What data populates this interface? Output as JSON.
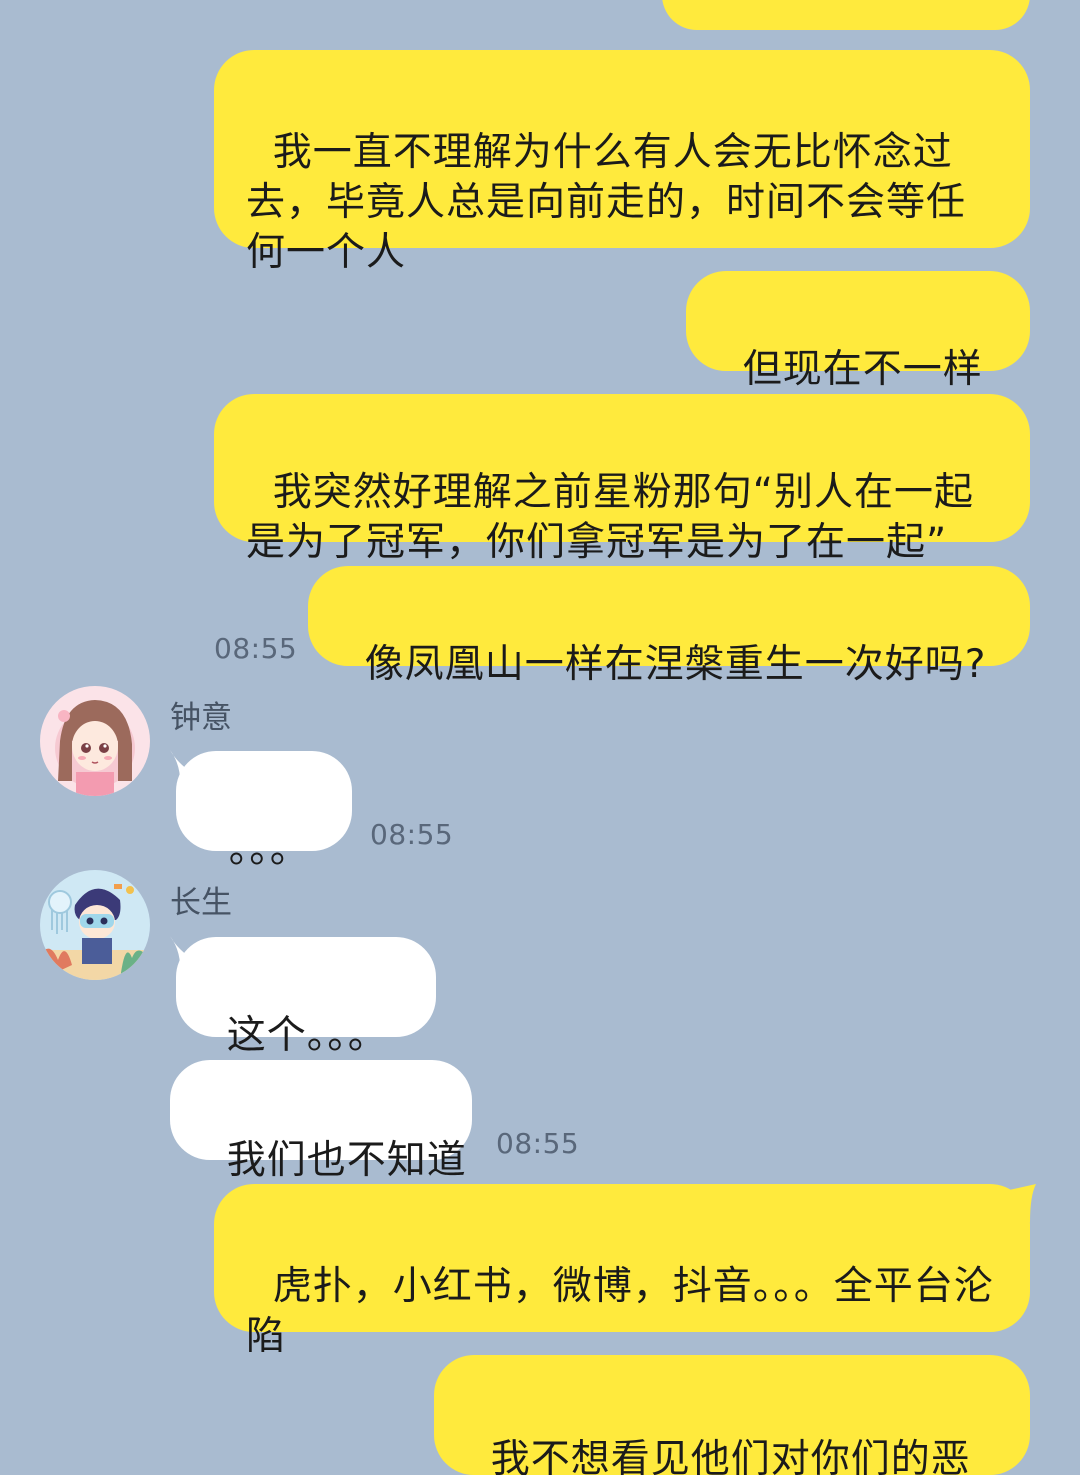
{
  "messages": {
    "m1": {
      "text": "我一直不理解为什么有人会无比怀念过去，毕竟人总是向前走的，时间不会等任何一个人"
    },
    "m2": {
      "text": "但现在不一样了"
    },
    "m3": {
      "text": "我突然好理解之前星粉那句“别人在一起是为了冠军，你们拿冠军是为了在一起”"
    },
    "m4": {
      "text": "像凤凰山一样在涅槃重生一次好吗?"
    },
    "time1": "08:55",
    "sender1": {
      "name": "钟意",
      "text": "。。。",
      "time": "08:55"
    },
    "sender2": {
      "name": "长生",
      "text1": "这个。。。",
      "text2": "我们也不知道",
      "time": "08:55"
    },
    "m5": {
      "text": "虎扑，小红书，微博，抖音。。。全平台沦陷"
    },
    "m6": {
      "text": "我不想看见他们对你们的恶意"
    }
  },
  "colors": {
    "background": "#a9bbd0",
    "my_bubble": "#ffea3d",
    "their_bubble": "#ffffff"
  }
}
